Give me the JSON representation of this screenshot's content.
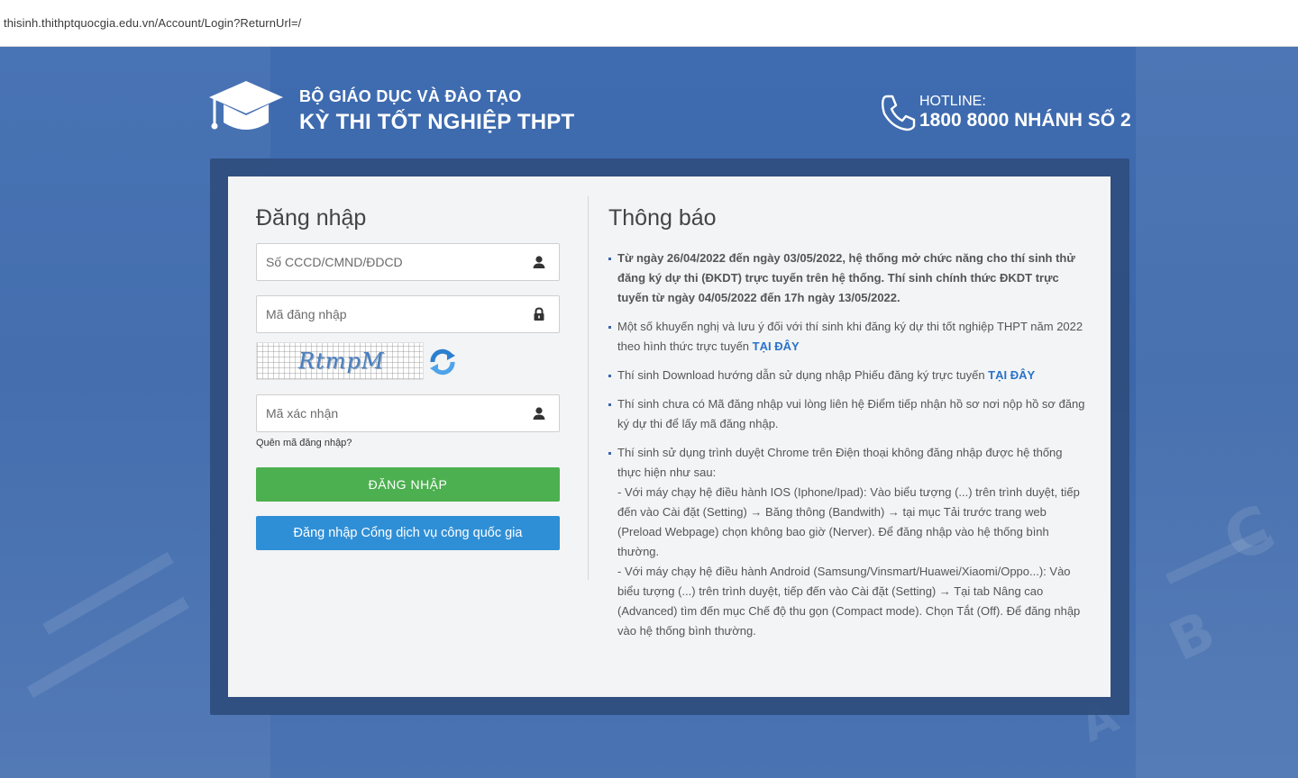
{
  "browser": {
    "url": "thisinh.thithptquocgia.edu.vn/Account/Login?ReturnUrl=/"
  },
  "header": {
    "org": "BỘ GIÁO DỤC VÀ ĐÀO TẠO",
    "exam": "KỲ THI TỐT NGHIỆP THPT",
    "hotline_label": "HOTLINE:",
    "hotline_number": "1800 8000 NHÁNH SỐ 2"
  },
  "login": {
    "title": "Đăng nhập",
    "id_placeholder": "Số CCCD/CMND/ĐDCD",
    "code_placeholder": "Mã đăng nhập",
    "captcha_text": "RtmpM",
    "verify_placeholder": "Mã xác nhận",
    "forgot": "Quên mã đăng nhập?",
    "login_button": "ĐĂNG NHẬP",
    "gov_button": "Đăng nhập Cổng dịch vụ công quốc gia"
  },
  "notice": {
    "title": "Thông báo",
    "item1": "Từ ngày 26/04/2022 đến ngày 03/05/2022, hệ thống mở chức năng cho thí sinh thử đăng ký dự thi (ĐKDT) trực tuyến trên hệ thống. Thí sinh chính thức ĐKDT trực tuyến từ ngày 04/05/2022 đến 17h ngày 13/05/2022.",
    "item2_text": "Một số khuyến nghị và lưu ý đối với thí sinh khi đăng ký dự thi tốt nghiệp THPT năm 2022 theo hình thức trực tuyến ",
    "item2_link": "TẠI ĐÂY",
    "item3_text": "Thí sinh Download hướng dẫn sử dụng nhập Phiếu đăng ký trực tuyến ",
    "item3_link": "TẠI ĐÂY",
    "item4": "Thí sinh chưa có Mã đăng nhập vui lòng liên hệ Điểm tiếp nhận hồ sơ nơi nộp hồ sơ đăng ký dự thi để lấy mã đăng nhập.",
    "item5_intro": "Thí sinh sử dụng trình duyệt Chrome trên Điện thoại không đăng nhập được hệ thống thực hiện như sau:",
    "item5_ios": " - Với máy chạy hệ điều hành IOS (Iphone/Ipad): Vào biểu tượng (...) trên trình duyệt, tiếp đến vào Cài đặt (Setting) → Băng thông (Bandwith) → tại mục Tải trước trang web (Preload Webpage) chọn không bao giờ (Nerver). Để đăng nhập vào hệ thống bình thường.",
    "item5_android": " - Với máy chạy hệ điều hành Android (Samsung/Vinsmart/Huawei/Xiaomi/Oppo...): Vào biểu tượng (...) trên trình duyệt, tiếp đến vào Cài đặt (Setting) → Tại tab Nâng cao (Advanced) tìm đến mục Chế độ thu gọn (Compact mode). Chọn Tắt (Off). Để đăng nhập vào hệ thống bình thường."
  }
}
